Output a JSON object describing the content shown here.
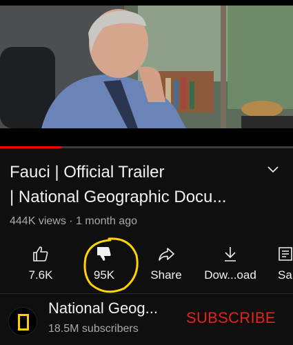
{
  "player": {
    "progress_fraction": 0.21
  },
  "video": {
    "title_line1": "Fauci | Official Trailer",
    "title_line2": "| National Geographic Docu...",
    "meta": "444K views · 1 month ago"
  },
  "actions": [
    {
      "label": "7.6K",
      "icon": "thumbs-up-icon"
    },
    {
      "label": "95K",
      "icon": "thumbs-down-icon"
    },
    {
      "label": "Share",
      "icon": "share-icon"
    },
    {
      "label": "Dow...oad",
      "icon": "download-icon"
    },
    {
      "label": "Sa",
      "icon": "save-icon"
    }
  ],
  "channel": {
    "name": "National Geog...",
    "subscribers": "18.5M subscribers",
    "subscribe_label": "SUBSCRIBE"
  },
  "colors": {
    "accent_red": "#ff0000",
    "subscribe_red": "#e62117",
    "highlight_yellow": "#ffd400",
    "ng_yellow": "#ffce00"
  }
}
